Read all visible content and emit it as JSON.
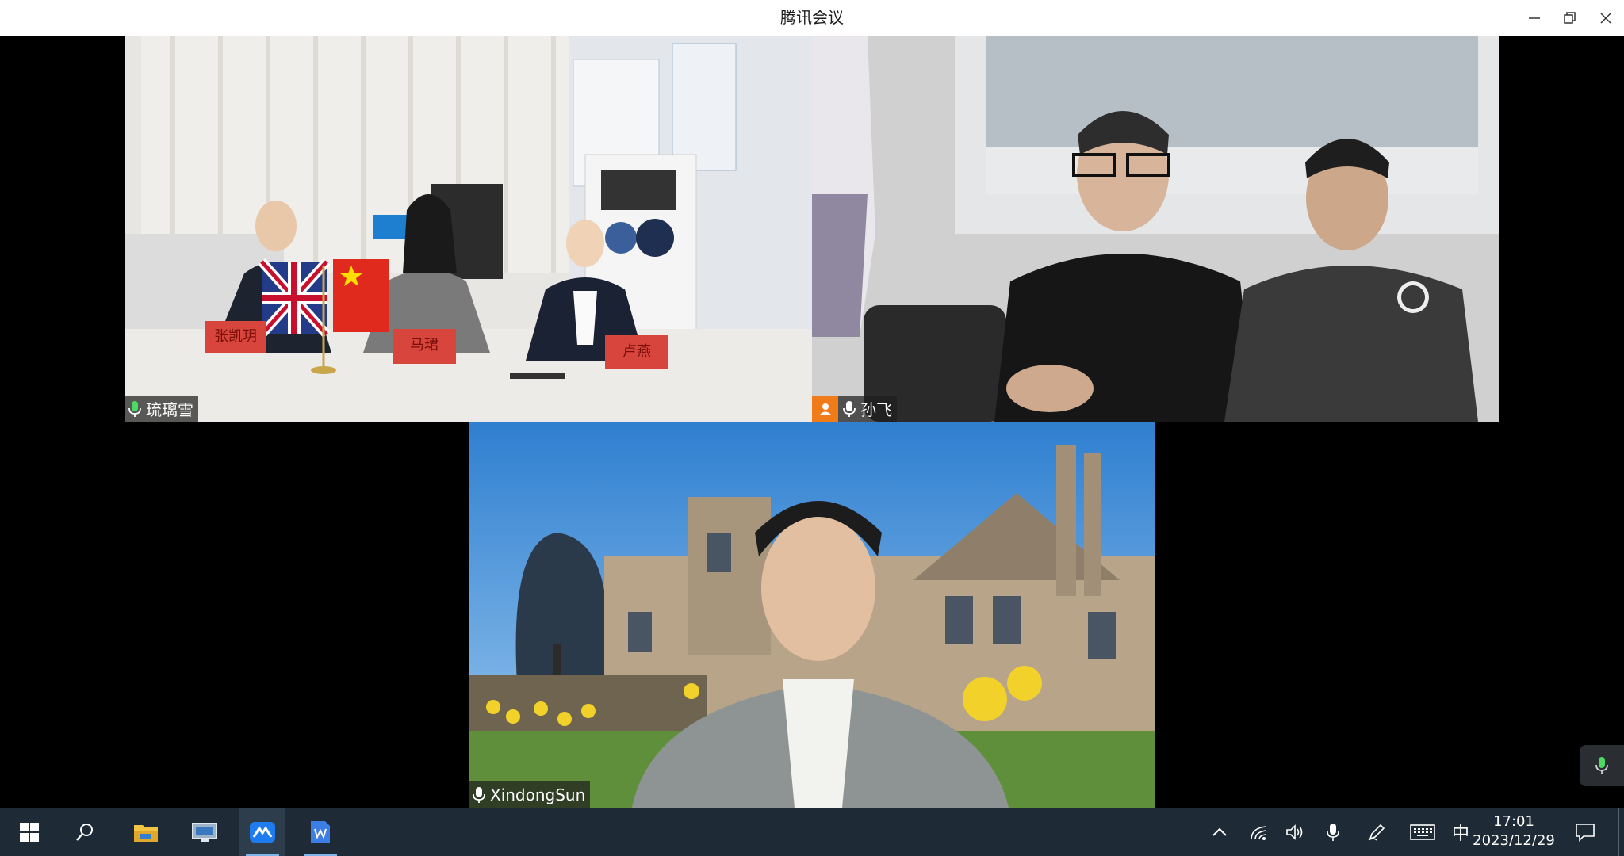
{
  "window": {
    "title": "腾讯会议"
  },
  "participants": [
    {
      "name": "琉璃雪",
      "mic": "active"
    },
    {
      "name": "孙飞",
      "mic": "on",
      "host_badge": true
    },
    {
      "name": "XindongSun",
      "mic": "on"
    }
  ],
  "placards": [
    "张凯玥",
    "马珺",
    "卢燕"
  ],
  "taskbar": {
    "time": "17:01",
    "date": "2023/12/29",
    "ime": "中"
  },
  "colors": {
    "active_border": "#3fb36b",
    "speaking_mic": "#4cd964",
    "host_badge": "#f07b18",
    "taskbar_bg": "#1e2b36"
  }
}
